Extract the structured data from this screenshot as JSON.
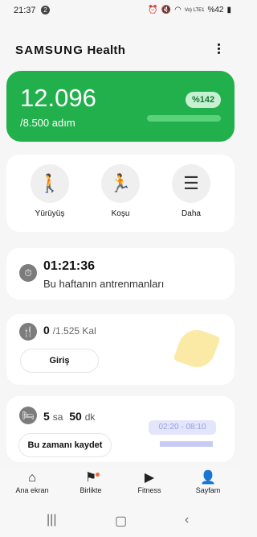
{
  "status": {
    "time": "21:37",
    "notif_count": "2",
    "battery": "%42",
    "signal": "Vo) LTE1"
  },
  "app": {
    "brand_left": "SAMSUNG",
    "brand_right": "Health"
  },
  "steps": {
    "value": "12.096",
    "goal": "/8.500 adım",
    "percent_badge": "%142",
    "progress": 1.0,
    "color": "#21b04b"
  },
  "activities": {
    "walk_label": "Yürüyüş",
    "run_label": "Koşu",
    "more_label": "Daha"
  },
  "exercise": {
    "time": "01:21:36",
    "subtitle": "Bu haftanın antrenmanları"
  },
  "food": {
    "value": "0",
    "goal": "/1.525 Kal",
    "button": "Giriş"
  },
  "sleep": {
    "hours": "5",
    "hours_unit": "sa",
    "minutes": "50",
    "minutes_unit": "dk",
    "button": "Bu zamanı kaydet",
    "range": "02:20 - 08:10"
  },
  "nav": {
    "home": "Ana ekran",
    "together": "Birlikte",
    "fitness": "Fitness",
    "me": "Sayfam"
  }
}
